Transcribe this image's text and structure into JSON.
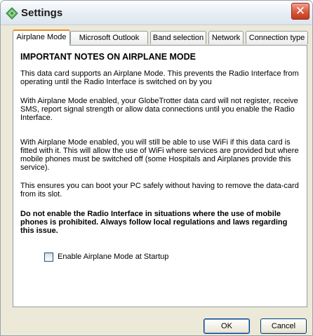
{
  "window": {
    "title": "Settings",
    "icon": "settings-diamond-icon",
    "close_symbol": "✕"
  },
  "tabs": [
    {
      "label": "Airplane Mode",
      "active": true
    },
    {
      "label": "Microsoft Outlook",
      "active": false
    },
    {
      "label": "Band selection",
      "active": false
    },
    {
      "label": "Network",
      "active": false
    },
    {
      "label": "Connection type",
      "active": false
    }
  ],
  "content": {
    "heading": "IMPORTANT NOTES ON AIRPLANE MODE",
    "paragraphs": [
      "This data card supports an Airplane Mode. This prevents the Radio Interface from operating until the Radio Interface is switched on by you",
      "With Airplane Mode enabled, your GlobeTrotter data card will not register, receive SMS, report signal strength or allow data connections until you enable the Radio Interface.",
      "With Airplane Mode enabled, you will still be able to use WiFi if this data card is fitted with it. This will allow the use of WiFi where services are provided but where mobile phones must be switched off (some Hospitals and Airplanes provide this service).",
      "This ensures you can boot your PC safely without having to remove the data-card from its slot."
    ],
    "warning": "Do not enable the Radio Interface in situations where the use of mobile phones is prohibited. Always follow local regulations and laws regarding this issue.",
    "checkbox_label": "Enable Airplane Mode at Startup",
    "checkbox_checked": false
  },
  "buttons": {
    "ok": "OK",
    "cancel": "Cancel"
  }
}
